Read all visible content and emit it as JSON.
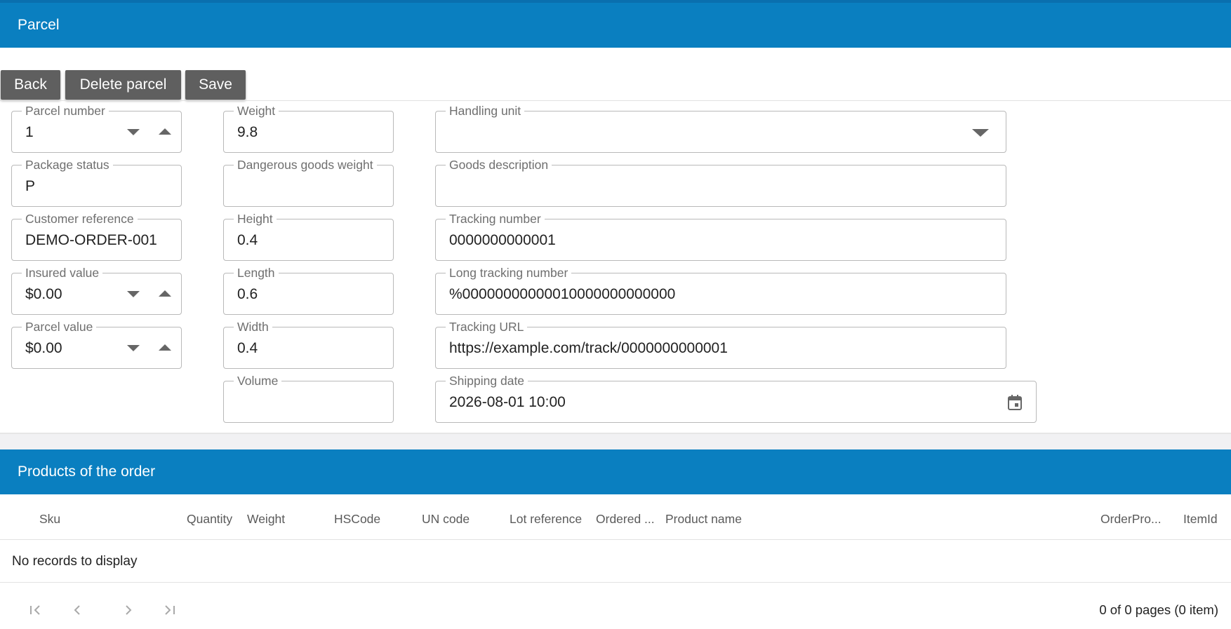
{
  "parcel": {
    "title": "Parcel",
    "toolbar": {
      "back_label": "Back",
      "delete_label": "Delete parcel",
      "save_label": "Save"
    },
    "fields": {
      "parcel_number": {
        "label": "Parcel number",
        "value": "1"
      },
      "package_status": {
        "label": "Package status",
        "value": "P"
      },
      "customer_reference": {
        "label": "Customer reference",
        "value": "DEMO-ORDER-001"
      },
      "insured_value": {
        "label": "Insured value",
        "value": "$0.00"
      },
      "parcel_value": {
        "label": "Parcel value",
        "value": "$0.00"
      },
      "weight": {
        "label": "Weight",
        "value": "9.8"
      },
      "dangerous_goods_weight": {
        "label": "Dangerous goods weight",
        "value": ""
      },
      "height": {
        "label": "Height",
        "value": "0.4"
      },
      "length": {
        "label": "Length",
        "value": "0.6"
      },
      "width": {
        "label": "Width",
        "value": "0.4"
      },
      "volume": {
        "label": "Volume",
        "value": ""
      },
      "handling_unit": {
        "label": "Handling unit",
        "value": ""
      },
      "goods_description": {
        "label": "Goods description",
        "value": ""
      },
      "tracking_number": {
        "label": "Tracking number",
        "value": "0000000000001"
      },
      "long_tracking_number": {
        "label": "Long tracking number",
        "value": "%00000000000010000000000000"
      },
      "tracking_url": {
        "label": "Tracking URL",
        "value": "https://example.com/track/0000000000001"
      },
      "shipping_date": {
        "label": "Shipping date",
        "value": "2026-08-01 10:00"
      }
    }
  },
  "products": {
    "title": "Products of the order",
    "columns": [
      "Sku",
      "Quantity",
      "Weight",
      "HSCode",
      "UN code",
      "Lot reference",
      "Ordered ...",
      "Product name",
      "OrderPro...",
      "ItemId"
    ],
    "empty_text": "No records to display",
    "pager_info": "0 of 0 pages (0 item)"
  },
  "icons": {
    "spinner": [
      "chevron-down-icon",
      "chevron-up-icon"
    ],
    "dropdown": "dropdown-arrow-icon",
    "calendar": "calendar-icon",
    "pager": [
      "first-page-icon",
      "previous-page-icon",
      "next-page-icon",
      "last-page-icon"
    ]
  },
  "colors": {
    "header_bg": "#0a7fc0",
    "button_bg": "#5f5f5f"
  }
}
